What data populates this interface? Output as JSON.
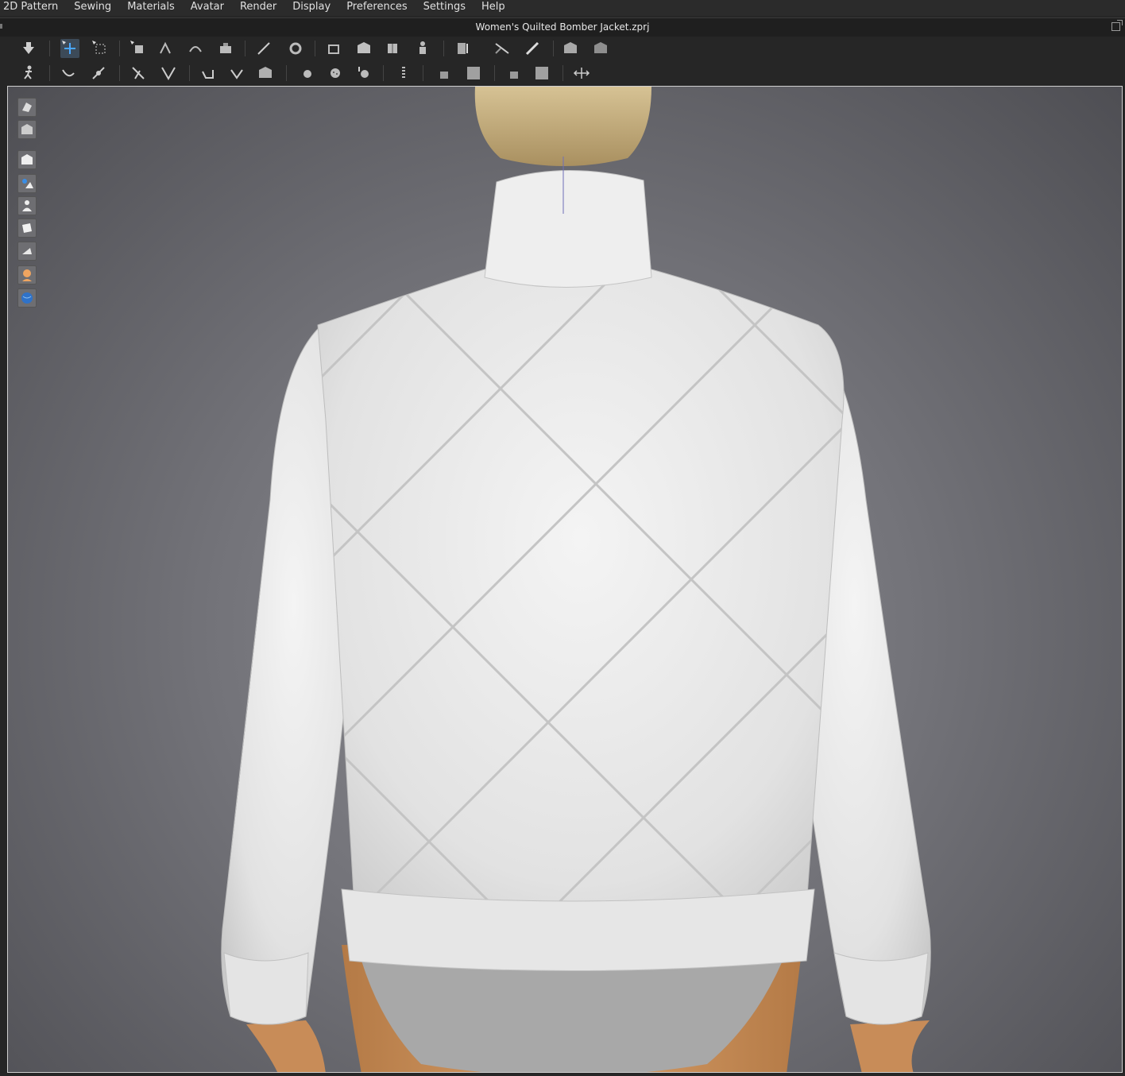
{
  "menu": {
    "items": [
      {
        "label": "2D Pattern"
      },
      {
        "label": "Sewing"
      },
      {
        "label": "Materials"
      },
      {
        "label": "Avatar"
      },
      {
        "label": "Render"
      },
      {
        "label": "Display"
      },
      {
        "label": "Preferences"
      },
      {
        "label": "Settings"
      },
      {
        "label": "Help"
      }
    ]
  },
  "window": {
    "title": "Women's Quilted Bomber Jacket.zprj"
  },
  "toolbar1": {
    "tools": [
      "simulation-icon",
      "select-move-icon",
      "select-mesh-icon",
      "move-pin-icon",
      "transform-icon",
      "fold-icon",
      "steam-icon",
      "measure-line-icon",
      "tape-measure-icon",
      "arrangement-point-icon",
      "pattern-copy-icon",
      "reset-2d-icon",
      "reset-3d-icon",
      "avatar-fit-icon",
      "strengthen-icon",
      "tack-icon",
      "fitting-tack-icon",
      "ruler-icon"
    ]
  },
  "toolbar2": {
    "tools": [
      "avatar-pose-icon",
      "edit-curvature-icon",
      "edit-point-icon",
      "seam-line-icon",
      "pleat-icon",
      "shirring-icon",
      "gathering-icon",
      "button-icon",
      "buttonhole-icon",
      "snap-icon",
      "zipper-icon",
      "topstitch-icon",
      "puckering-icon",
      "texture-icon",
      "overlay-icon",
      "flip-icon"
    ]
  },
  "viewport": {
    "side_tools": [
      "show-3d-pattern-icon",
      "show-3d-garment-icon",
      "garment-display-icon",
      "fabric-display-icon",
      "avatar-display-icon",
      "texture-surface-icon",
      "thickness-icon",
      "skin-icon",
      "environment-icon"
    ],
    "colors": {
      "background": "#76767c",
      "jacket": "#e6e6e6",
      "hair": "#c9b486",
      "skin": "#c98e58",
      "underwear": "#a9a9a9",
      "selection_accent": "#2e88d8"
    }
  }
}
